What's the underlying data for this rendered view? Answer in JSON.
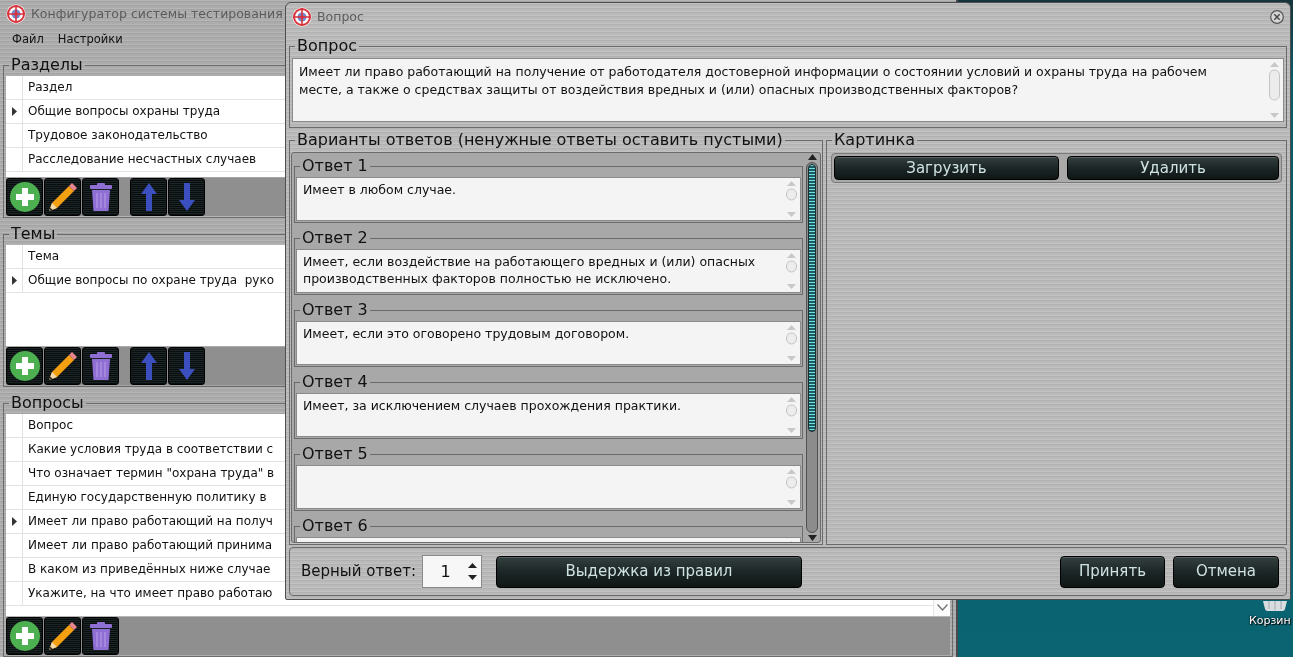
{
  "main_window": {
    "title": "Конфигуратор системы тестирования",
    "menu": [
      {
        "label": "Файл"
      },
      {
        "label": "Настройки"
      }
    ],
    "sections": {
      "title": "Разделы",
      "column": "Раздел",
      "rows": [
        {
          "text": "Общие вопросы охраны труда",
          "selected": true
        },
        {
          "text": "Трудовое законодательство",
          "selected": false
        },
        {
          "text": "Расследование несчастных случаев",
          "selected": false
        }
      ],
      "toolbar": [
        {
          "kind": "add"
        },
        {
          "kind": "edit"
        },
        {
          "kind": "delete"
        },
        {
          "kind": "move_up"
        },
        {
          "kind": "move_down"
        }
      ]
    },
    "topics": {
      "title": "Темы",
      "column": "Тема",
      "rows": [
        {
          "text": "Общие вопросы по охране труда  руко",
          "selected": true
        }
      ],
      "toolbar": [
        {
          "kind": "add"
        },
        {
          "kind": "edit"
        },
        {
          "kind": "delete"
        },
        {
          "kind": "move_up"
        },
        {
          "kind": "move_down"
        }
      ]
    },
    "questions": {
      "title": "Вопросы",
      "column": "Вопрос",
      "rows": [
        {
          "text": "Какие условия труда в соответствии с",
          "selected": false
        },
        {
          "text": "Что означает термин \"охрана труда\" в",
          "selected": false
        },
        {
          "text": "Единую государственную политику в",
          "selected": false
        },
        {
          "text": "Имеет ли право работающий на получ",
          "selected": true
        },
        {
          "text": "Имеет ли право работающий принима",
          "selected": false
        },
        {
          "text": "В каком из приведённых ниже случае",
          "selected": false
        },
        {
          "text": "Укажите, на что имеет право работаю",
          "selected": false
        }
      ],
      "toolbar": [
        {
          "kind": "add"
        },
        {
          "kind": "edit"
        },
        {
          "kind": "delete"
        }
      ]
    }
  },
  "dialog": {
    "title": "Вопрос",
    "question": {
      "title": "Вопрос",
      "text": "Имеет ли право работающий на получение от работодателя достоверной информации о состоянии условий и охраны труда на рабочем месте, а также о средствах защиты от воздействия вредных и (или) опасных производственных факторов?"
    },
    "answers": {
      "title": "Варианты ответов (ненужные ответы оставить пустыми)",
      "items": [
        {
          "label": "Ответ 1",
          "text": "Имеет в любом случае."
        },
        {
          "label": "Ответ 2",
          "text": "Имеет, если воздействие на работающего вредных и (или) опасных производственных факторов полностью не исключено."
        },
        {
          "label": "Ответ 3",
          "text": "Имеет, если это оговорено трудовым договором."
        },
        {
          "label": "Ответ 4",
          "text": "Имеет, за исключением случаев прохождения практики."
        },
        {
          "label": "Ответ 5"
        },
        {
          "label": "Ответ 6"
        }
      ]
    },
    "picture": {
      "title": "Картинка",
      "buttons": [
        {
          "label": "Загрузить"
        },
        {
          "label": "Удалить"
        }
      ]
    },
    "correct_answer": {
      "label": "Верный ответ:",
      "value": "1"
    },
    "rules_button": "Выдержка из правил",
    "buttons": [
      {
        "label": "Принять"
      },
      {
        "label": "Отмена"
      }
    ]
  },
  "desktop": {
    "icons": [
      {
        "label": "Корзин"
      }
    ]
  }
}
